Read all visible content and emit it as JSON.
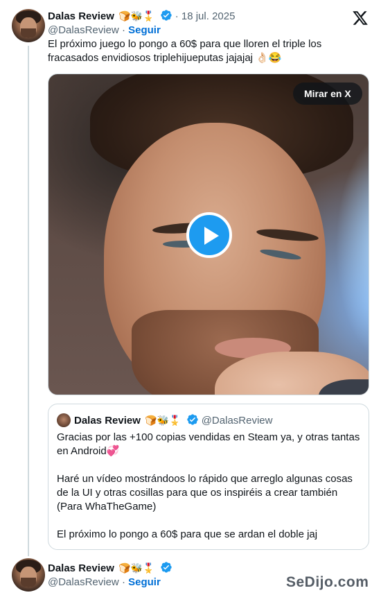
{
  "tweet": {
    "author_name": "Dalas Review",
    "name_emojis": "🍞🐝🎖️",
    "date": "18 jul. 2025",
    "handle": "@DalasReview",
    "follow_label": "Seguir",
    "text": "El próximo juego lo pongo a 60$ para que lloren el triple los fracasados envidiosos triplehijueputas jajajaj 👌🏻😂",
    "media": {
      "watch_label": "Mirar en X"
    }
  },
  "quoted_tweet": {
    "author_name": "Dalas Review",
    "name_emojis": "🍞🐝🎖️",
    "handle": "@DalasReview",
    "paragraphs": [
      "Gracias por las +100 copias vendidas en Steam ya, y otras tantas en Android💞",
      "Haré un vídeo mostrándoos lo rápido que arreglo algunas cosas de la UI y otras cosillas para que os inspiréis a crear también (Para WhaTheGame)",
      "El próximo lo pongo a 60$ para que se ardan el doble jaj"
    ]
  },
  "reply_tweet": {
    "author_name": "Dalas Review",
    "name_emojis": "🍞🐝🎖️",
    "handle": "@DalasReview",
    "follow_label": "Seguir"
  },
  "watermark": "SeDijo.com",
  "icons": {
    "verified": "verified-badge-icon",
    "platform": "x-logo-icon",
    "play": "play-icon"
  },
  "colors": {
    "accent": "#1d9bf0",
    "follow": "#006fd6",
    "muted": "#536471"
  }
}
